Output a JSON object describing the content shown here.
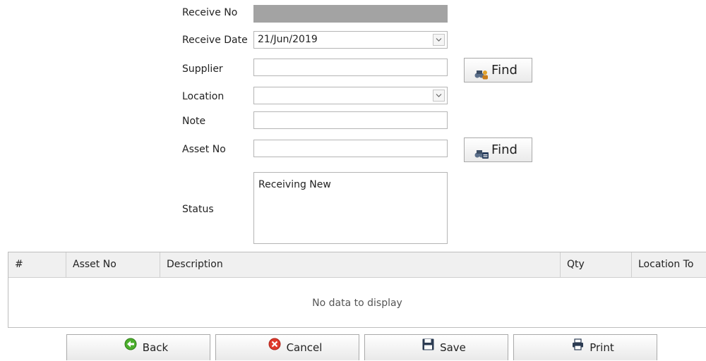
{
  "form": {
    "receive_no": {
      "label": "Receive No",
      "value": ""
    },
    "receive_date": {
      "label": "Receive Date",
      "value": "21/Jun/2019"
    },
    "supplier": {
      "label": "Supplier",
      "value": "",
      "find_label": "Find"
    },
    "location": {
      "label": "Location",
      "value": ""
    },
    "note": {
      "label": "Note",
      "value": ""
    },
    "asset_no": {
      "label": "Asset No",
      "value": "",
      "find_label": "Find"
    },
    "status": {
      "label": "Status",
      "value": "Receiving New"
    }
  },
  "grid": {
    "columns": [
      "#",
      "Asset No",
      "Description",
      "Qty",
      "Location To"
    ],
    "empty_text": "No data to display"
  },
  "actions": {
    "back": "Back",
    "cancel": "Cancel",
    "save": "Save",
    "print": "Print"
  },
  "icons": {
    "supplier_find": "binoculars-person-icon",
    "asset_find": "binoculars-id-icon",
    "back": "back-arrow-icon",
    "cancel": "cancel-x-icon",
    "save": "floppy-disk-icon",
    "print": "printer-icon"
  }
}
